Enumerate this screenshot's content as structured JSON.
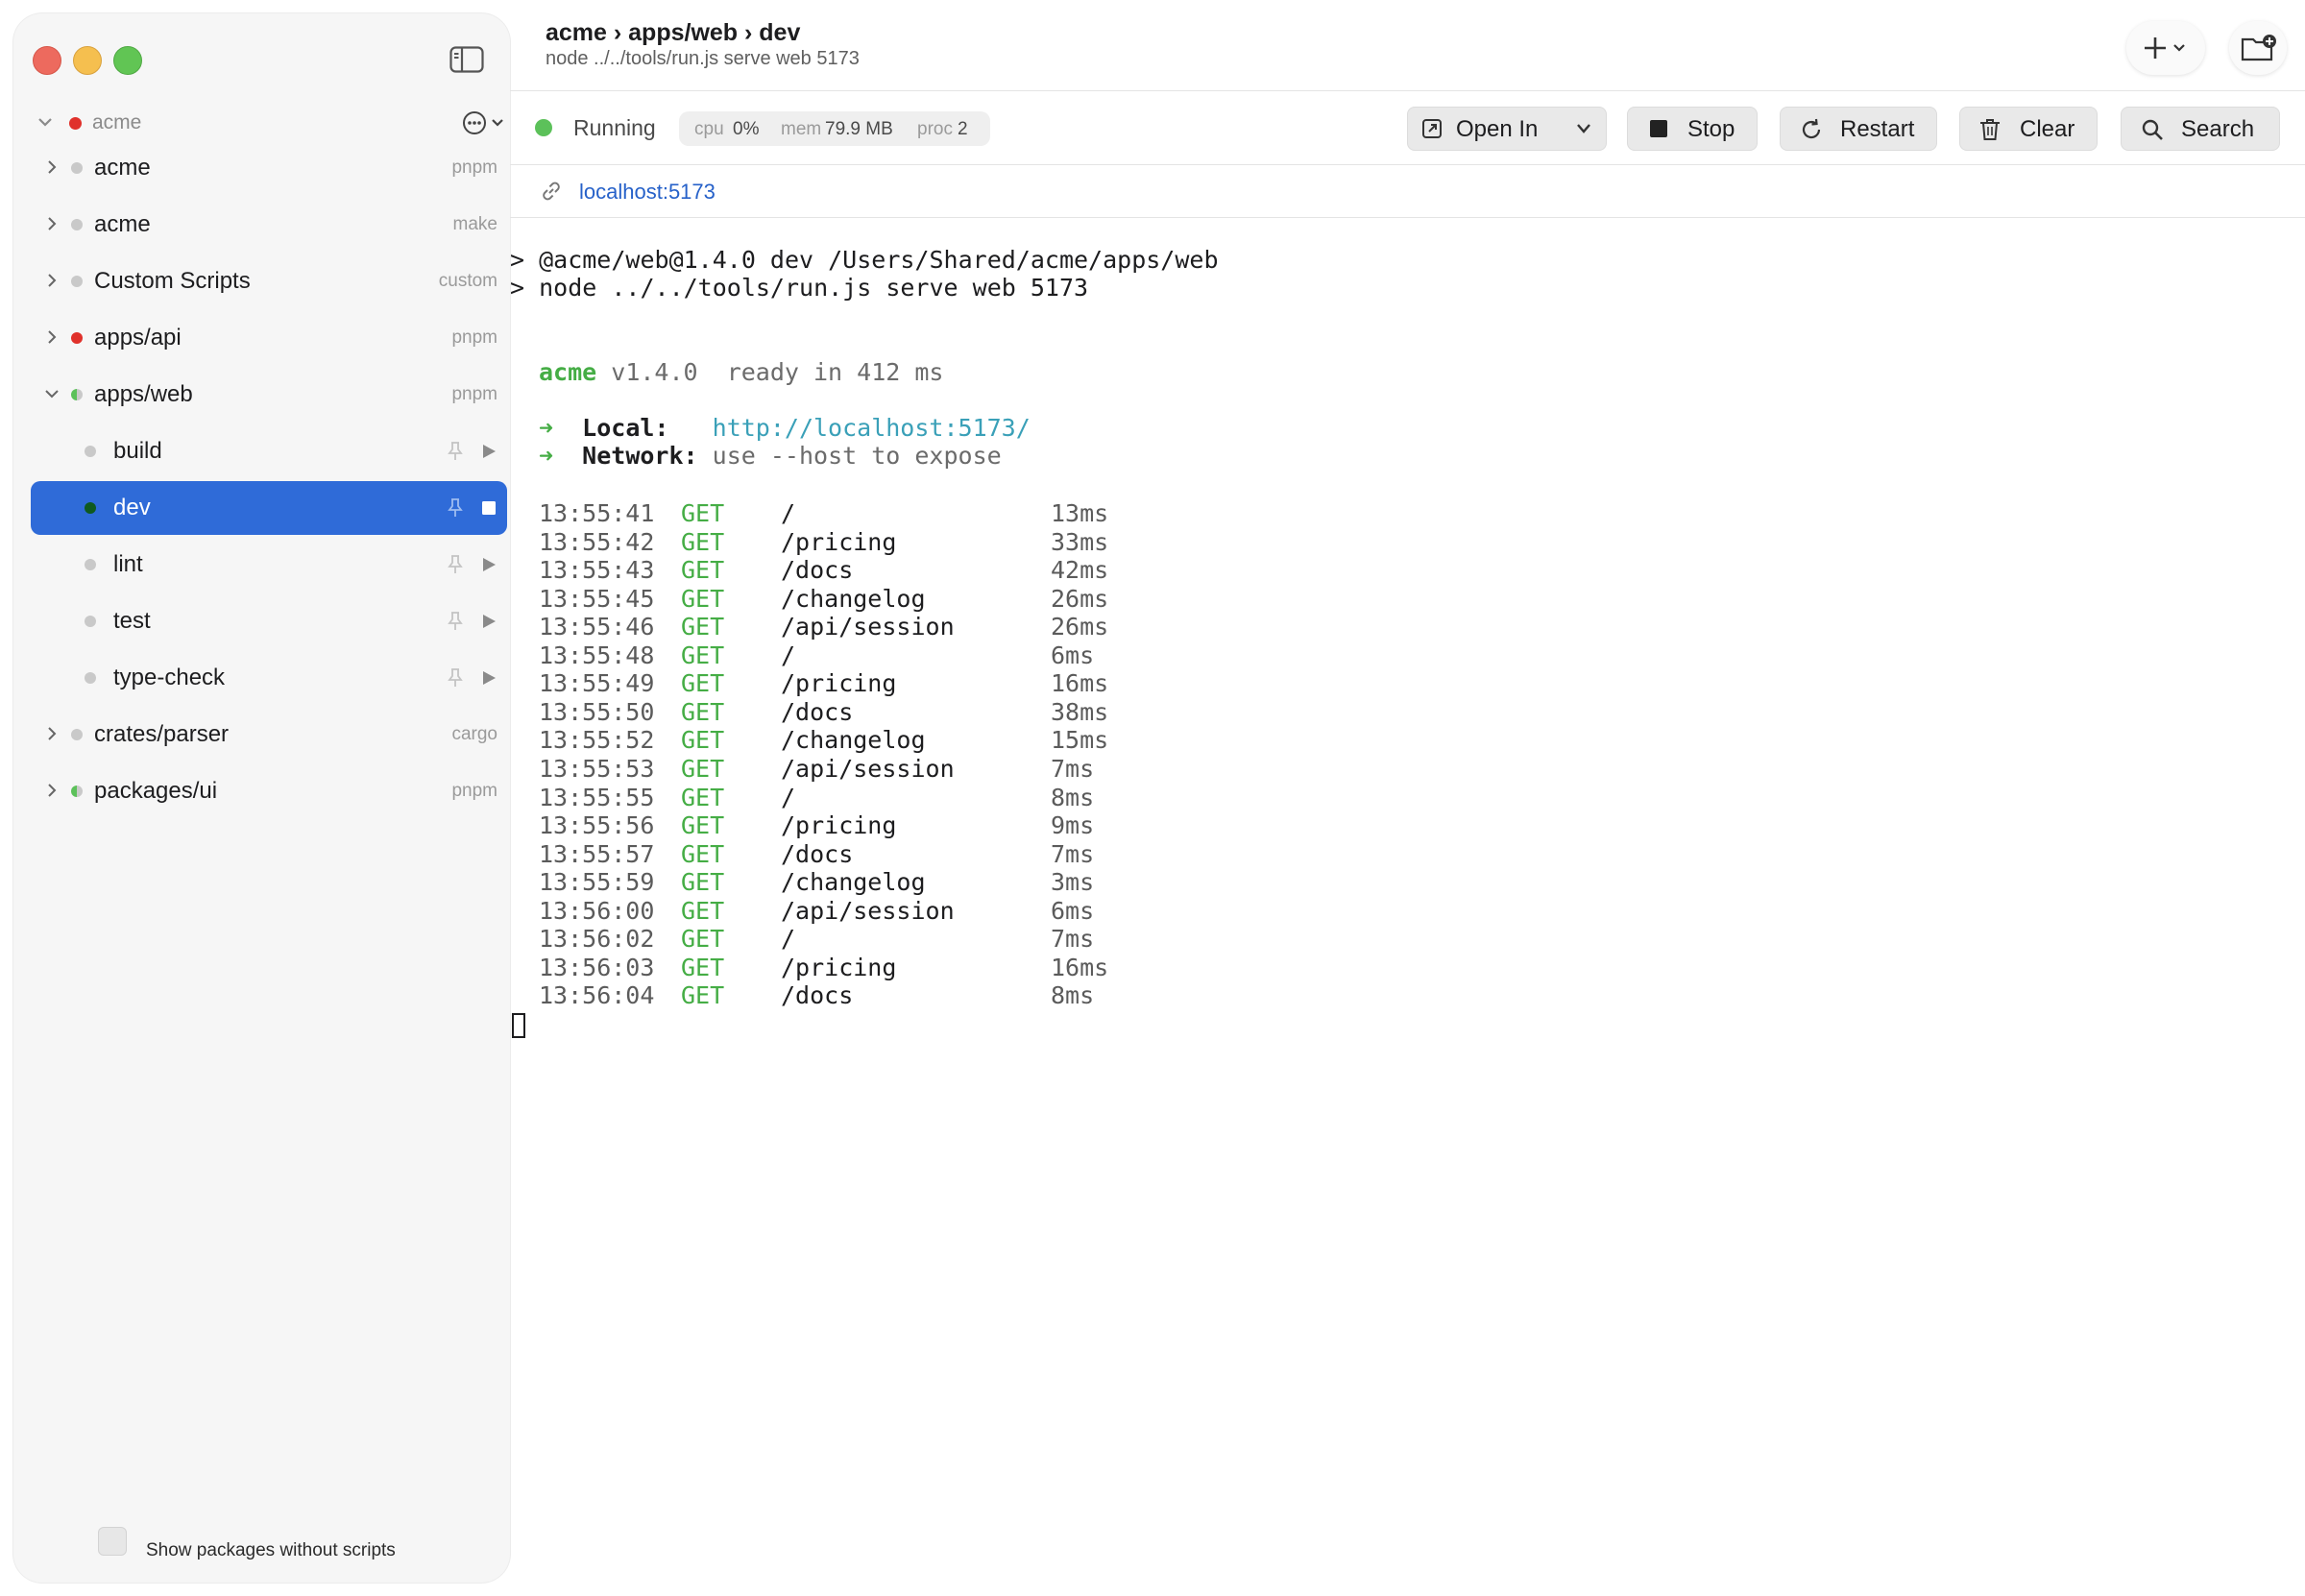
{
  "sidebar": {
    "workspace": "acme",
    "items": [
      {
        "label": "acme",
        "tag": "pnpm"
      },
      {
        "label": "acme",
        "tag": "make"
      },
      {
        "label": "Custom Scripts",
        "tag": "custom"
      },
      {
        "label": "apps/api",
        "tag": "pnpm"
      },
      {
        "label": "apps/web",
        "tag": "pnpm"
      },
      {
        "label": "crates/parser",
        "tag": "cargo"
      },
      {
        "label": "packages/ui",
        "tag": "pnpm"
      }
    ],
    "scripts": [
      {
        "label": "build"
      },
      {
        "label": "dev"
      },
      {
        "label": "lint"
      },
      {
        "label": "test"
      },
      {
        "label": "type-check"
      }
    ],
    "footer_label": "Show packages without scripts"
  },
  "header": {
    "title": "acme › apps/web › dev",
    "subtitle": "node ../../tools/run.js serve web 5173"
  },
  "status": {
    "text": "Running",
    "cpu_label": "cpu",
    "cpu_value": "0%",
    "mem_label": "mem",
    "mem_value": "79.9 MB",
    "proc_label": "proc",
    "proc_value": "2"
  },
  "toolbar": {
    "open_in": "Open In",
    "stop": "Stop",
    "restart": "Restart",
    "clear": "Clear",
    "search": "Search"
  },
  "link": "localhost:5173",
  "terminal": {
    "cmd1": "> @acme/web@1.4.0 dev /Users/Shared/acme/apps/web",
    "cmd2": "> node ../../tools/run.js serve web 5173",
    "brand": "acme",
    "version": "v1.4.0",
    "ready": "ready in 412 ms",
    "arrow": "➜",
    "local_label": "Local:",
    "local_url": "http://localhost:5173/",
    "network_label": "Network:",
    "network_value": "use --host to expose",
    "logs": [
      {
        "time": "13:55:41",
        "method": "GET",
        "path": "/",
        "dur": "13ms"
      },
      {
        "time": "13:55:42",
        "method": "GET",
        "path": "/pricing",
        "dur": "33ms"
      },
      {
        "time": "13:55:43",
        "method": "GET",
        "path": "/docs",
        "dur": "42ms"
      },
      {
        "time": "13:55:45",
        "method": "GET",
        "path": "/changelog",
        "dur": "26ms"
      },
      {
        "time": "13:55:46",
        "method": "GET",
        "path": "/api/session",
        "dur": "26ms"
      },
      {
        "time": "13:55:48",
        "method": "GET",
        "path": "/",
        "dur": "6ms"
      },
      {
        "time": "13:55:49",
        "method": "GET",
        "path": "/pricing",
        "dur": "16ms"
      },
      {
        "time": "13:55:50",
        "method": "GET",
        "path": "/docs",
        "dur": "38ms"
      },
      {
        "time": "13:55:52",
        "method": "GET",
        "path": "/changelog",
        "dur": "15ms"
      },
      {
        "time": "13:55:53",
        "method": "GET",
        "path": "/api/session",
        "dur": "7ms"
      },
      {
        "time": "13:55:55",
        "method": "GET",
        "path": "/",
        "dur": "8ms"
      },
      {
        "time": "13:55:56",
        "method": "GET",
        "path": "/pricing",
        "dur": "9ms"
      },
      {
        "time": "13:55:57",
        "method": "GET",
        "path": "/docs",
        "dur": "7ms"
      },
      {
        "time": "13:55:59",
        "method": "GET",
        "path": "/changelog",
        "dur": "3ms"
      },
      {
        "time": "13:56:00",
        "method": "GET",
        "path": "/api/session",
        "dur": "6ms"
      },
      {
        "time": "13:56:02",
        "method": "GET",
        "path": "/",
        "dur": "7ms"
      },
      {
        "time": "13:56:03",
        "method": "GET",
        "path": "/pricing",
        "dur": "16ms"
      },
      {
        "time": "13:56:04",
        "method": "GET",
        "path": "/docs",
        "dur": "8ms"
      }
    ]
  },
  "colors": {
    "accent": "#2f6bd8",
    "running": "#5cc15a",
    "error": "#e0312b",
    "log_method": "#45ad45",
    "link": "#2661c9"
  }
}
